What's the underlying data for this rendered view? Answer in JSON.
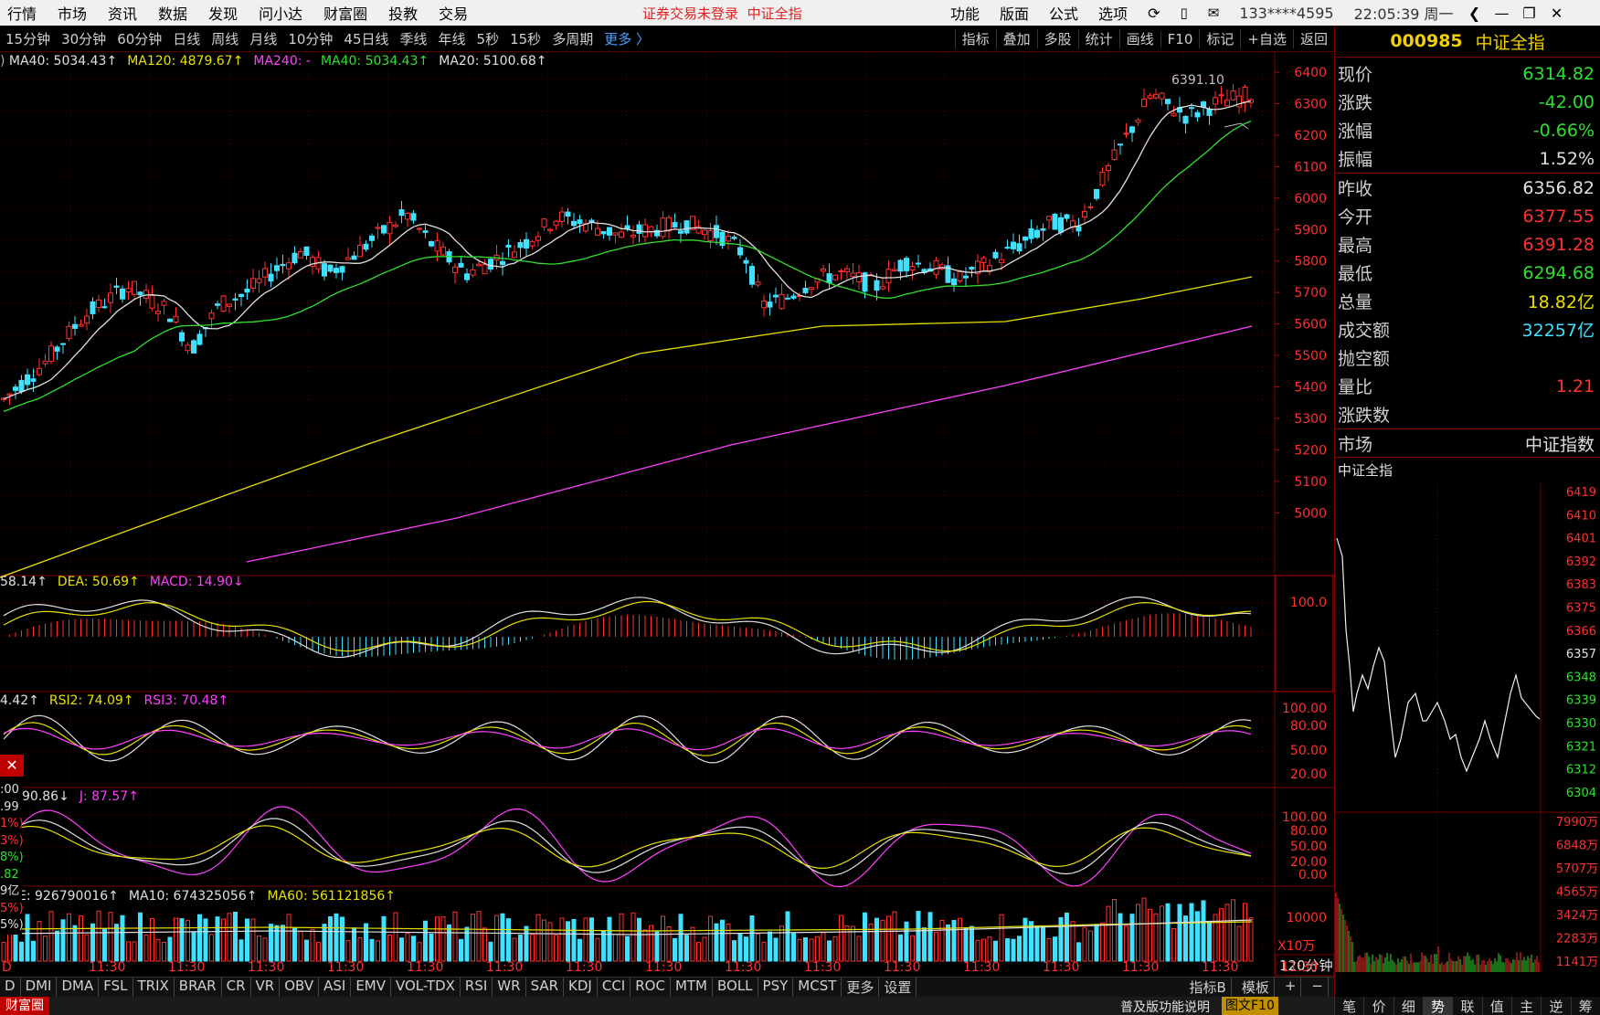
{
  "menubar": {
    "items": [
      "行情",
      "市场",
      "资讯",
      "数据",
      "发现",
      "问小达",
      "财富圈",
      "投教",
      "交易"
    ],
    "warning": "证券交易未登录",
    "warning2": "中证全指",
    "right_items": [
      "功能",
      "版面",
      "公式",
      "选项"
    ],
    "account": "133****4595",
    "time": "22:05:39 周一"
  },
  "periodbar": {
    "items": [
      "15分钟",
      "30分钟",
      "60分钟",
      "日线",
      "周线",
      "月线",
      "10分钟",
      "45日线",
      "季线",
      "年线",
      "5秒",
      "15秒",
      "多周期"
    ],
    "more": "更多 〉",
    "tools": [
      "指标",
      "叠加",
      "多股",
      "统计",
      "画线",
      "F10",
      "标记",
      "+自选",
      "返回"
    ]
  },
  "main_legend": {
    "items": [
      {
        "text": "MA40: 5034.43↑",
        "color": "#e0e0e0"
      },
      {
        "text": "MA120: 4879.67↑",
        "color": "#e8e000"
      },
      {
        "text": "MA240: -",
        "color": "#ff40ff"
      },
      {
        "text": "MA40: 5034.43↑",
        "color": "#30e030"
      },
      {
        "text": "MA20: 5100.68↑",
        "color": "#e0e0e0"
      }
    ],
    "high_label": "6391.10"
  },
  "price_axis": [
    "6400",
    "6300",
    "6200",
    "6100",
    "6000",
    "5900",
    "5800",
    "5700",
    "5600",
    "5500",
    "5400",
    "5300",
    "5200",
    "5100",
    "5000"
  ],
  "macd_legend": {
    "items": [
      {
        "text": "58.14↑",
        "color": "#e0e0e0"
      },
      {
        "text": "DEA: 50.69↑",
        "color": "#e8e000"
      },
      {
        "text": "MACD: 14.90↓",
        "color": "#ff40ff"
      }
    ],
    "axis": [
      "100.0"
    ]
  },
  "rsi_legend": {
    "items": [
      {
        "text": "4.42↑",
        "color": "#e0e0e0"
      },
      {
        "text": "RSI2: 74.09↑",
        "color": "#e8e000"
      },
      {
        "text": "RSI3: 70.48↑",
        "color": "#ff40ff"
      }
    ],
    "axis": [
      "100.00",
      "80.00",
      "50.00",
      "20.00"
    ]
  },
  "kdj_legend": {
    "items": [
      {
        "text": "90.86↓",
        "color": "#e0e0e0"
      },
      {
        "text": "J: 87.57↑",
        "color": "#ff40ff"
      }
    ],
    "axis": [
      "100.00",
      "80.00",
      "50.00",
      "20.00",
      "0.00"
    ]
  },
  "vol_legend": {
    "items": [
      {
        "text": "E: 926790016↑",
        "color": "#e0e0e0"
      },
      {
        "text": "MA10: 674325056↑",
        "color": "#e0e0e0"
      },
      {
        "text": "MA60: 561121856↑",
        "color": "#e8e000"
      }
    ],
    "axis": [
      "10000"
    ],
    "unit": "X10万",
    "period": "120分钟"
  },
  "left_overlay": [
    ":00",
    ".99",
    "1%)",
    "3%)",
    "8%)",
    ".82",
    "9亿",
    "5%)",
    "5%)"
  ],
  "time_labels": [
    "D",
    "11:30",
    "11:30",
    "11:30",
    "11:30",
    "11:30",
    "11:30",
    "11:30",
    "11:30",
    "11:30",
    "11:30",
    "11:30",
    "11:30",
    "11:30",
    "11:30",
    "11:30",
    "11:30"
  ],
  "indicator_tabs": [
    "D",
    "DMI",
    "DMA",
    "FSL",
    "TRIX",
    "BRAR",
    "CR",
    "VR",
    "OBV",
    "ASI",
    "EMV",
    "VOL-TDX",
    "RSI",
    "WR",
    "SAR",
    "KDJ",
    "CCI",
    "ROC",
    "MTM",
    "BOLL",
    "PSY",
    "MCST",
    "更多",
    "设置"
  ],
  "indicator_right": [
    "指标B",
    "模板",
    "+",
    "−"
  ],
  "status": {
    "left": "财富圈",
    "right": "普及版功能说明",
    "right2": "图文F10"
  },
  "info": {
    "code": "000985",
    "name": "中证全指",
    "rows": [
      {
        "label": "现价",
        "value": "6314.82",
        "color": "#30e030"
      },
      {
        "label": "涨跌",
        "value": "-42.00",
        "color": "#30e030"
      },
      {
        "label": "涨幅",
        "value": "-0.66%",
        "color": "#30e030"
      },
      {
        "label": "振幅",
        "value": "1.52%",
        "color": "#e0e0e0"
      }
    ],
    "rows2": [
      {
        "label": "昨收",
        "value": "6356.82",
        "color": "#e0e0e0"
      },
      {
        "label": "今开",
        "value": "6377.55",
        "color": "#ff3030"
      },
      {
        "label": "最高",
        "value": "6391.28",
        "color": "#ff3030"
      },
      {
        "label": "最低",
        "value": "6294.68",
        "color": "#30e030"
      },
      {
        "label": "总量",
        "value": "18.82亿",
        "color": "#e8e000"
      },
      {
        "label": "成交额",
        "value": "32257亿",
        "color": "#40e0ff"
      },
      {
        "label": "抛空额",
        "value": "",
        "color": "#e0e0e0"
      },
      {
        "label": "量比",
        "value": "1.21",
        "color": "#ff3030"
      },
      {
        "label": "涨跌数",
        "value": "",
        "color": "#e0e0e0"
      }
    ],
    "market_label": "市场",
    "market_value": "中证指数",
    "mini_title": "中证全指",
    "mini_price_axis": [
      "6419",
      "6410",
      "6401",
      "6392",
      "6383",
      "6375",
      "6366",
      "6357",
      "6348",
      "6339",
      "6330",
      "6321",
      "6312",
      "6304"
    ],
    "mini_vol_axis": [
      "7990万",
      "6848万",
      "5707万",
      "4565万",
      "3424万",
      "2283万",
      "1141万"
    ],
    "bottom_tabs": [
      "笔",
      "价",
      "细",
      "势",
      "联",
      "值",
      "主",
      "逆",
      "筹"
    ],
    "active_tab": "势"
  }
}
